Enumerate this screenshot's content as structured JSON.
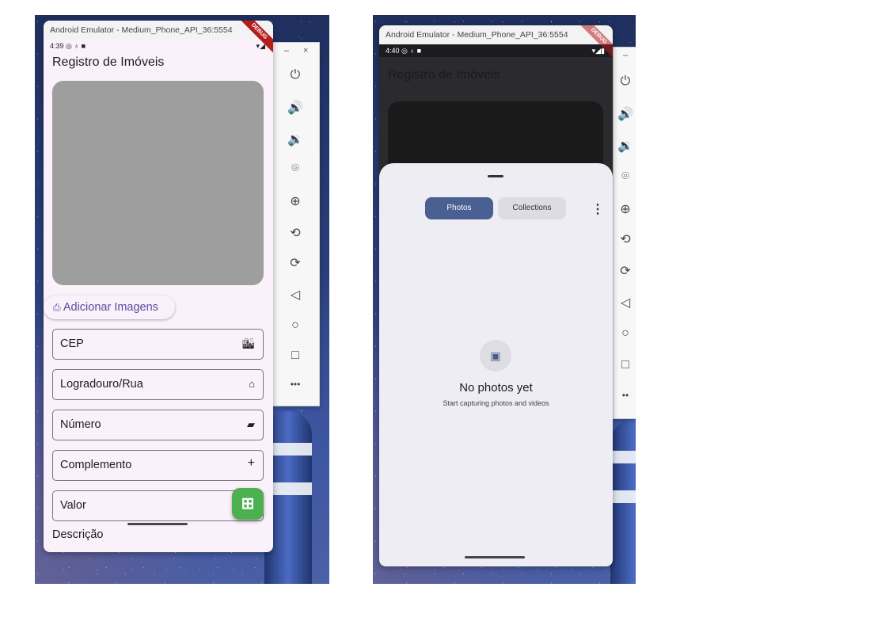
{
  "left": {
    "window_title": "Android Emulator - Medium_Phone_API_36:5554",
    "status_time": "4:39",
    "status_left_icons": "◎ ♁ ■",
    "status_right_icons": "▾◢",
    "debug_label": "DEBUG",
    "app_title": "Registro de Imóveis",
    "add_images_label": "Adicionar Imagens",
    "fields": [
      {
        "label": "CEP",
        "icon": "city-icon",
        "glyph": "🏙"
      },
      {
        "label": "Logradouro/Rua",
        "icon": "home-icon",
        "glyph": "⌂"
      },
      {
        "label": "Número",
        "icon": "label-icon",
        "glyph": "▰"
      },
      {
        "label": "Complemento",
        "icon": "plus-icon",
        "glyph": "+"
      },
      {
        "label": "Valor",
        "icon": "money-icon",
        "glyph": ""
      }
    ],
    "partial_label": "Descrição",
    "fab_color": "#4caf50"
  },
  "right": {
    "window_title": "Android Emulator - Medium_Phone_API_36:5554",
    "status_time": "4:40",
    "status_left_icons": "◎ ♁ ■",
    "status_right_icons": "▾◢▮",
    "debug_label": "DEBUG",
    "app_title": "Registro de Imóveis",
    "tabs": [
      {
        "label": "Photos",
        "selected": true
      },
      {
        "label": "Collections",
        "selected": false
      }
    ],
    "more_icon": "⋮",
    "empty_title": "No photos yet",
    "empty_subtitle": "Start capturing photos and videos",
    "accent_color": "#4a5f92"
  },
  "emulator_controls": {
    "minimize": "–",
    "close": "×",
    "buttons": [
      "power-icon",
      "volume-up-icon",
      "volume-down-icon",
      "camera-icon",
      "zoom-in-icon",
      "rotate-left-icon",
      "rotate-right-icon",
      "back-icon",
      "home-icon",
      "overview-icon",
      "more-icon"
    ],
    "glyphs": [
      "⏻",
      "🔊",
      "🔉",
      "⌾",
      "⊕",
      "⟲",
      "⟳",
      "◁",
      "○",
      "□",
      "•••"
    ]
  }
}
